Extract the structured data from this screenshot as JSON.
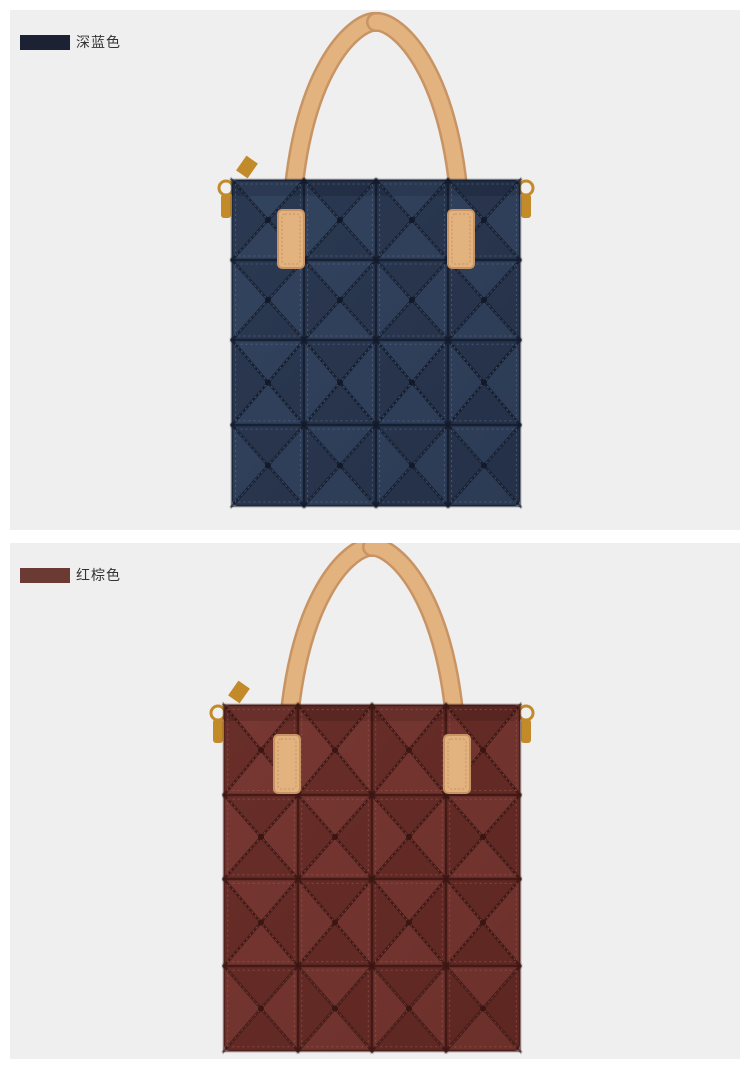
{
  "variants": [
    {
      "label": "深蓝色",
      "swatch_color": "#1c2233",
      "bag_color": "#253148",
      "bag_light": "#33445f",
      "seam_color": "#121a2a",
      "stitch_color": "#5a6e90"
    },
    {
      "label": "红棕色",
      "swatch_color": "#6b3a33",
      "bag_color": "#5e2722",
      "bag_light": "#783833",
      "seam_color": "#3a1512",
      "stitch_color": "#9a5a50"
    }
  ],
  "colors": {
    "background": "#efefef",
    "strap": "#e2b27f",
    "strap_shade": "#c89464",
    "hardware": "#c38a2a"
  }
}
